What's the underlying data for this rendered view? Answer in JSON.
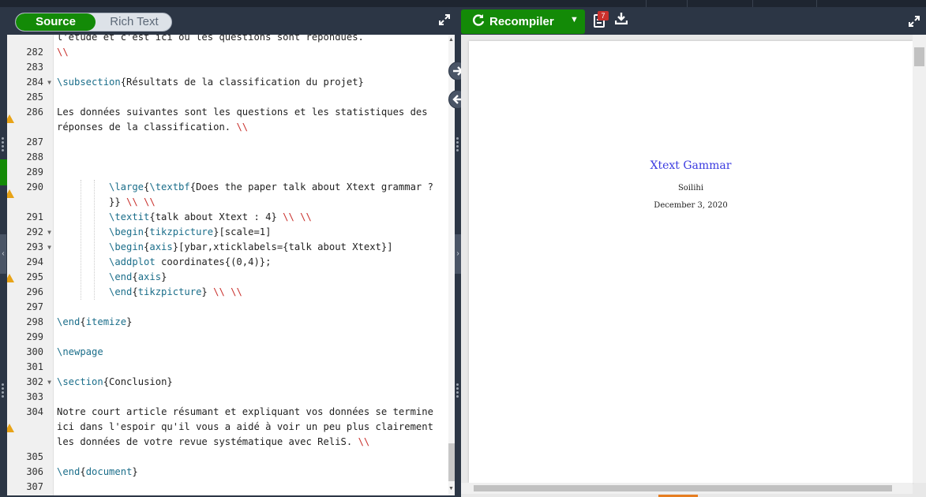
{
  "toolbar": {
    "source_label": "Source",
    "rich_text_label": "Rich Text",
    "recompile_label": "Recompiler",
    "logs_count": "7"
  },
  "editor": {
    "partial_line": "l'étude et c'est ici où les questions sont répondues.",
    "lines": [
      {
        "n": "282"
      },
      {
        "n": "283"
      },
      {
        "n": "284"
      },
      {
        "n": "285"
      },
      {
        "n": "286"
      },
      {
        "n": "287"
      },
      {
        "n": "288"
      },
      {
        "n": "289"
      },
      {
        "n": "290"
      },
      {
        "n": "291"
      },
      {
        "n": "292"
      },
      {
        "n": "293"
      },
      {
        "n": "294"
      },
      {
        "n": "295"
      },
      {
        "n": "296"
      },
      {
        "n": "297"
      },
      {
        "n": "298"
      },
      {
        "n": "299"
      },
      {
        "n": "300"
      },
      {
        "n": "301"
      },
      {
        "n": "302"
      },
      {
        "n": "303"
      },
      {
        "n": "304"
      },
      {
        "n": "305"
      },
      {
        "n": "306"
      },
      {
        "n": "307"
      }
    ],
    "code": {
      "l282": "\\\\",
      "l284_cmd": "\\subsection",
      "l284_arg": "{Résultats de la classification du projet}",
      "l286_a": "Les données suivantes sont les questions et les statistiques des",
      "l286_b": "réponses de la classification. ",
      "l286_b_end": "\\\\",
      "l290_cmd1": "\\large",
      "l290_mid": "{",
      "l290_cmd2": "\\textbf",
      "l290_arg": "{Does the paper talk about Xtext grammar ?",
      "l290_b": "}} ",
      "l290_b_end": "\\\\ \\\\",
      "l291_cmd": "\\textit",
      "l291_arg": "{talk about Xtext : 4} ",
      "l291_end": "\\\\ \\\\",
      "l292_cmd": "\\begin",
      "l292_env": "tikzpicture",
      "l292_rest": "[scale=1]",
      "l293_cmd": "\\begin",
      "l293_env": "axis",
      "l293_rest": "[ybar,xticklabels={talk about Xtext}]",
      "l294_cmd": "\\addplot",
      "l294_rest": " coordinates{(0,4)};",
      "l295_cmd": "\\end",
      "l295_env": "axis",
      "l296_cmd": "\\end",
      "l296_env": "tikzpicture",
      "l296_end": "\\\\ \\\\",
      "l298_cmd": "\\end",
      "l298_env": "itemize",
      "l300_cmd": "\\newpage",
      "l302_cmd": "\\section",
      "l302_arg": "{Conclusion}",
      "l304_a": "Notre court article résumant et expliquant vos données se termine",
      "l304_b": "ici dans l'espoir qu'il vous a aidé à voir un peu plus clairement",
      "l304_c": "les données de votre revue systématique avec ReliS. ",
      "l304_c_end": "\\\\",
      "l306_cmd": "\\end",
      "l306_env": "document"
    }
  },
  "pdf": {
    "title": "Xtext Gammar",
    "author": "Soilihi",
    "date": "December 3, 2020"
  },
  "colors": {
    "accent_green": "#138a07",
    "keyword": "#1b6e8a",
    "linebreak_red": "#c9302c",
    "pdf_title": "#3b3be0"
  },
  "icons": {
    "expand": "expand-icon",
    "recompile": "refresh-icon",
    "logs": "logs-icon",
    "download": "download-icon",
    "sync_right": "arrow-right-icon",
    "sync_left": "arrow-left-icon"
  }
}
